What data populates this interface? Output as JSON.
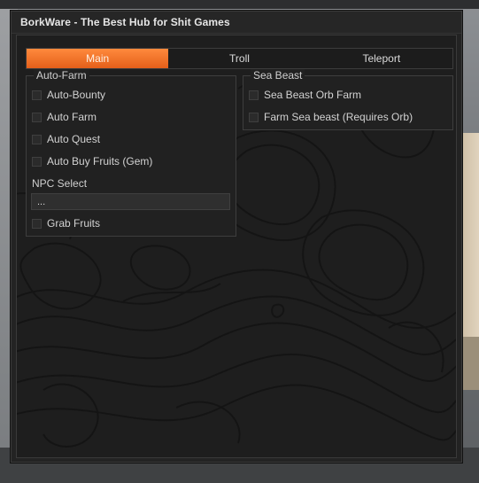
{
  "window": {
    "title": "BorkWare - The Best Hub for Shit Games"
  },
  "tabs": [
    {
      "label": "Main",
      "active": true
    },
    {
      "label": "Troll",
      "active": false
    },
    {
      "label": "Teleport",
      "active": false
    }
  ],
  "auto_farm": {
    "title": "Auto-Farm",
    "toggles": [
      {
        "label": "Auto-Bounty",
        "checked": false
      },
      {
        "label": "Auto Farm",
        "checked": false
      },
      {
        "label": "Auto Quest",
        "checked": false
      },
      {
        "label": "Auto Buy Fruits (Gem)",
        "checked": false
      }
    ],
    "npc_select": {
      "label": "NPC Select",
      "value": "..."
    },
    "extra_toggle": {
      "label": "Grab Fruits",
      "checked": false
    }
  },
  "sea_beast": {
    "title": "Sea Beast",
    "toggles": [
      {
        "label": "Sea Beast Orb Farm",
        "checked": false
      },
      {
        "label": "Farm Sea beast (Requires Orb)",
        "checked": false
      }
    ]
  },
  "colors": {
    "accent": "#f07328",
    "panel": "#212121",
    "background": "#1e1e1e"
  }
}
